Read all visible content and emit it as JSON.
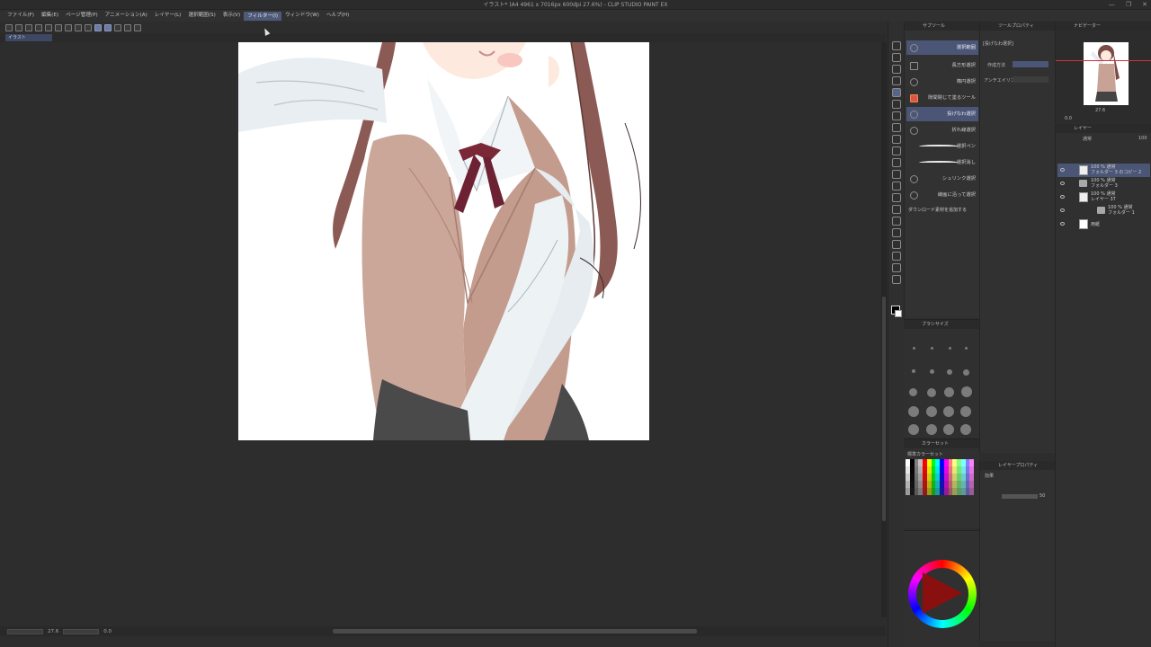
{
  "window": {
    "title": "イラスト* (A4 4961 x 7016px 600dpi 27.6%) - CLIP STUDIO PAINT EX",
    "controls": [
      "—",
      "❐",
      "✕"
    ]
  },
  "menu": {
    "items": [
      {
        "label": "ファイル(F)"
      },
      {
        "label": "編集(E)"
      },
      {
        "label": "ページ管理(P)"
      },
      {
        "label": "アニメーション(A)"
      },
      {
        "label": "レイヤー(L)"
      },
      {
        "label": "選択範囲(S)"
      },
      {
        "label": "表示(V)"
      },
      {
        "label": "フィルター(I)",
        "active": true
      },
      {
        "label": "ウィンドウ(W)"
      },
      {
        "label": "ヘルプ(H)"
      }
    ]
  },
  "document": {
    "tab_label": "イラスト"
  },
  "status": {
    "zoom": "27.6",
    "angle": "0.0"
  },
  "subtool_panel": {
    "header": "サブツール",
    "items": [
      {
        "label": "選択範囲",
        "icon": "dashed-rect-icon",
        "selected": true
      },
      {
        "label": "長方形選択",
        "icon": "rect-select-icon"
      },
      {
        "label": "楕円選択",
        "icon": "ellipse-select-icon"
      },
      {
        "label": "隙間閉じて塗るツール",
        "icon": "fill-icon"
      },
      {
        "label": "投げなわ選択",
        "icon": "lasso-icon",
        "selected": true
      },
      {
        "label": "折れ線選択",
        "icon": "polyline-icon"
      },
      {
        "label": "選択ペン",
        "icon": "stroke-icon"
      },
      {
        "label": "選択消し",
        "icon": "stroke-icon"
      },
      {
        "label": "シュリンク選択",
        "icon": "shrink-icon"
      },
      {
        "label": "線画に沿って選択",
        "icon": "lineart-icon"
      }
    ],
    "download_label": "ダウンロード素材を追加する"
  },
  "brush_panel": {
    "header": "ブラシサイズ"
  },
  "colorset_panel": {
    "header": "カラーセット",
    "set_name": "標準カラーセット",
    "swatch_colors": [
      "#ffffff",
      "#000000",
      "#808080",
      "#c0c0c0",
      "#ff0000",
      "#ffff00",
      "#00ff00",
      "#00ffff",
      "#0000ff",
      "#ff00ff",
      "#ff8080",
      "#ffff80",
      "#80ff80",
      "#80ffff",
      "#8080ff",
      "#ff80ff"
    ]
  },
  "tool_property": {
    "header": "ツールプロパティ",
    "title": "[投げなわ選択]",
    "rows": [
      {
        "label": "作成方法"
      },
      {
        "label": "アンチエイリアス"
      }
    ]
  },
  "navigator": {
    "header": "ナビゲーター",
    "zoom": "27.6",
    "angle": "0.0"
  },
  "layer_panel": {
    "header": "レイヤー",
    "blend_mode": "通常",
    "opacity": "100",
    "layers": [
      {
        "mode": "100 % 通常",
        "name": "フォルダー 3 のコピー 2",
        "type": "folder",
        "selected": true
      },
      {
        "mode": "100 % 通常",
        "name": "フォルダー 3",
        "type": "folder"
      },
      {
        "mode": "100 % 通常",
        "name": "レイヤー 37",
        "type": "raster"
      },
      {
        "mode": "100 % 通常",
        "name": "フォルダー 1",
        "type": "folder"
      },
      {
        "mode": "",
        "name": "用紙",
        "type": "paper"
      }
    ]
  },
  "layer_property": {
    "header": "レイヤープロパティ",
    "effect_label": "効果",
    "opacity_value": "50"
  }
}
